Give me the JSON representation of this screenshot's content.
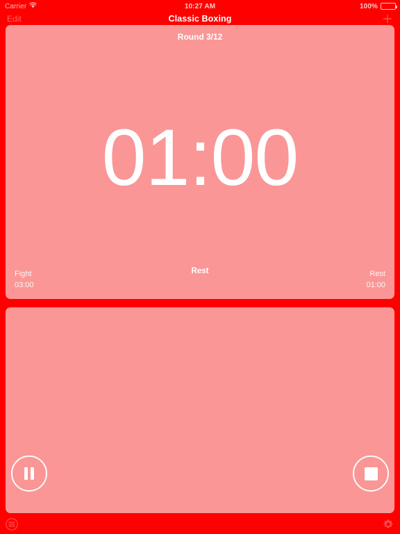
{
  "status_bar": {
    "carrier": "Carrier",
    "wifi_icon": "wifi-icon",
    "time": "10:27 AM",
    "battery_percent": "100%",
    "battery_icon": "battery-full-icon"
  },
  "nav_bar": {
    "edit_label": "Edit",
    "title": "Classic Boxing",
    "add_icon": "plus-icon"
  },
  "timer_panel": {
    "round_label": "Round 3/12",
    "time_remaining": "01:00",
    "phase_label": "Rest",
    "fight": {
      "name": "Fight",
      "duration": "03:00"
    },
    "rest": {
      "name": "Rest",
      "duration": "01:00"
    }
  },
  "controls_panel": {
    "pause_icon": "pause-icon",
    "stop_icon": "stop-icon"
  },
  "toolbar": {
    "list_icon": "list-icon",
    "settings_icon": "gear-icon"
  },
  "colors": {
    "background_red": "#ff0000",
    "panel_salmon": "#fa9696",
    "text_white": "#ffffff"
  }
}
